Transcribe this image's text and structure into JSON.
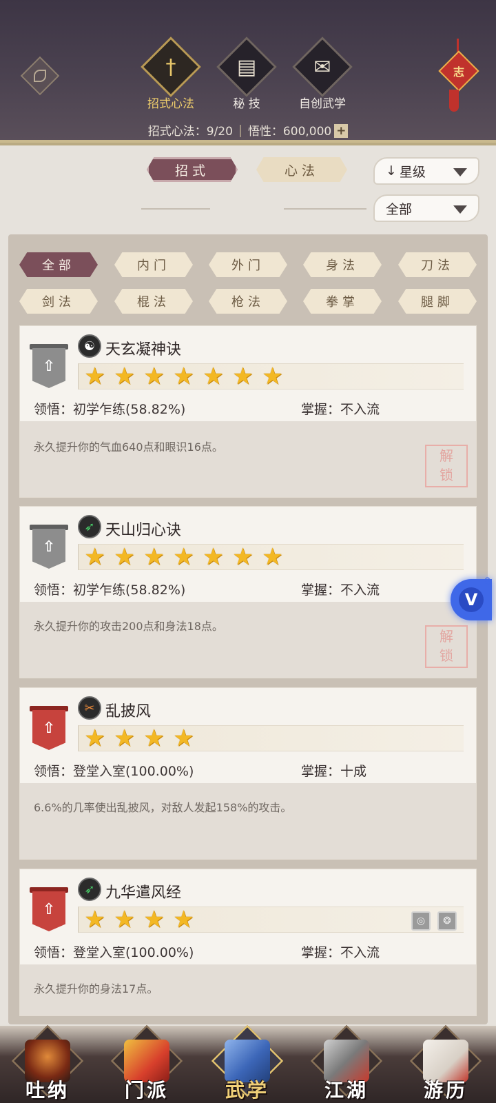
{
  "header": {
    "tabs": [
      {
        "label": "招式心法",
        "icon": "sword-icon",
        "active": true
      },
      {
        "label": "秘 技",
        "icon": "book-icon",
        "active": false
      },
      {
        "label": "自创武学",
        "icon": "scroll-icon",
        "active": false
      }
    ],
    "stats": {
      "moves_label": "招式心法：9/20",
      "insight_label": "悟性：600,000"
    },
    "knot_char": "志"
  },
  "sort": {
    "tabs": [
      {
        "label": "招式",
        "active": true
      },
      {
        "label": "心法",
        "active": false
      }
    ],
    "order_dropdown": "星级",
    "filter_dropdown": "全部"
  },
  "filters": [
    {
      "label": "全部",
      "active": true
    },
    {
      "label": "内门",
      "active": false
    },
    {
      "label": "外门",
      "active": false
    },
    {
      "label": "身法",
      "active": false
    },
    {
      "label": "刀法",
      "active": false
    },
    {
      "label": "剑法",
      "active": false
    },
    {
      "label": "棍法",
      "active": false
    },
    {
      "label": "枪法",
      "active": false
    },
    {
      "label": "拳掌",
      "active": false
    },
    {
      "label": "腿脚",
      "active": false
    }
  ],
  "skills": [
    {
      "name": "天玄凝神诀",
      "icon": "yin-yang-icon",
      "banner": "gray",
      "stars": 7,
      "comprehension_label": "领悟：",
      "comprehension": "初学乍练(58.82%)",
      "mastery_label": "掌握：",
      "mastery": "不入流",
      "description": "永久提升你的气血640点和眼识16点。",
      "seal": "解锁"
    },
    {
      "name": "天山归心诀",
      "icon": "boot-icon",
      "banner": "gray",
      "stars": 7,
      "comprehension_label": "领悟：",
      "comprehension": "初学乍练(58.82%)",
      "mastery_label": "掌握：",
      "mastery": "不入流",
      "description": "永久提升你的攻击200点和身法18点。",
      "seal": "解锁"
    },
    {
      "name": "乱披风",
      "icon": "blade-icon",
      "banner": "red",
      "stars": 4,
      "comprehension_label": "领悟：",
      "comprehension": "登堂入室(100.00%)",
      "mastery_label": "掌握：",
      "mastery": "十成",
      "description": "6.6%的几率使出乱披风，对敌人发起158%的攻击。"
    },
    {
      "name": "九华遣风经",
      "icon": "boot-icon",
      "banner": "red",
      "stars": 4,
      "comprehension_label": "领悟：",
      "comprehension": "登堂入室(100.00%)",
      "mastery_label": "掌握：",
      "mastery": "不入流",
      "description": "永久提升你的身法17点。"
    }
  ],
  "float_badge": {
    "letter": "V",
    "count": "8"
  },
  "bottom_nav": [
    {
      "label": "吐纳",
      "active": false
    },
    {
      "label": "门派",
      "active": false
    },
    {
      "label": "武学",
      "active": true
    },
    {
      "label": "江湖",
      "active": false
    },
    {
      "label": "游历",
      "active": false
    }
  ],
  "colors": {
    "header_bg": "#463d4c",
    "active_tab": "#7b4f5a",
    "star": "#f3b824",
    "gold_label": "#f0cf6c"
  }
}
